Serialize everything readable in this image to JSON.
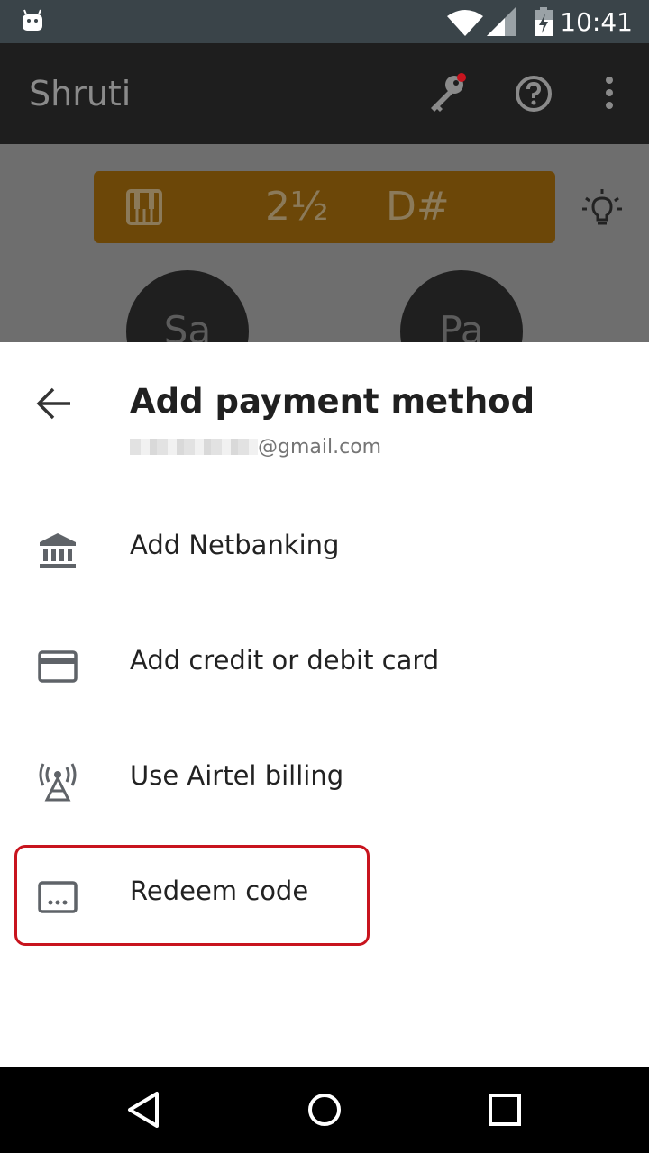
{
  "status_bar": {
    "time": "10:41"
  },
  "app_bar": {
    "title": "Shruti"
  },
  "pitch_bar": {
    "pitch": "2½",
    "note": "D#"
  },
  "swara": [
    "Sa",
    "Pa"
  ],
  "sheet": {
    "title": "Add payment method",
    "email": "@gmail.com",
    "items": [
      {
        "label": "Add Netbanking",
        "icon": "bank-icon"
      },
      {
        "label": "Add credit or debit card",
        "icon": "credit-card-icon"
      },
      {
        "label": "Use Airtel billing",
        "icon": "carrier-tower-icon"
      },
      {
        "label": "Redeem code",
        "icon": "redeem-code-icon"
      }
    ]
  },
  "colors": {
    "accent_highlight": "#c8141e",
    "pitch_bar": "#6c4708"
  }
}
